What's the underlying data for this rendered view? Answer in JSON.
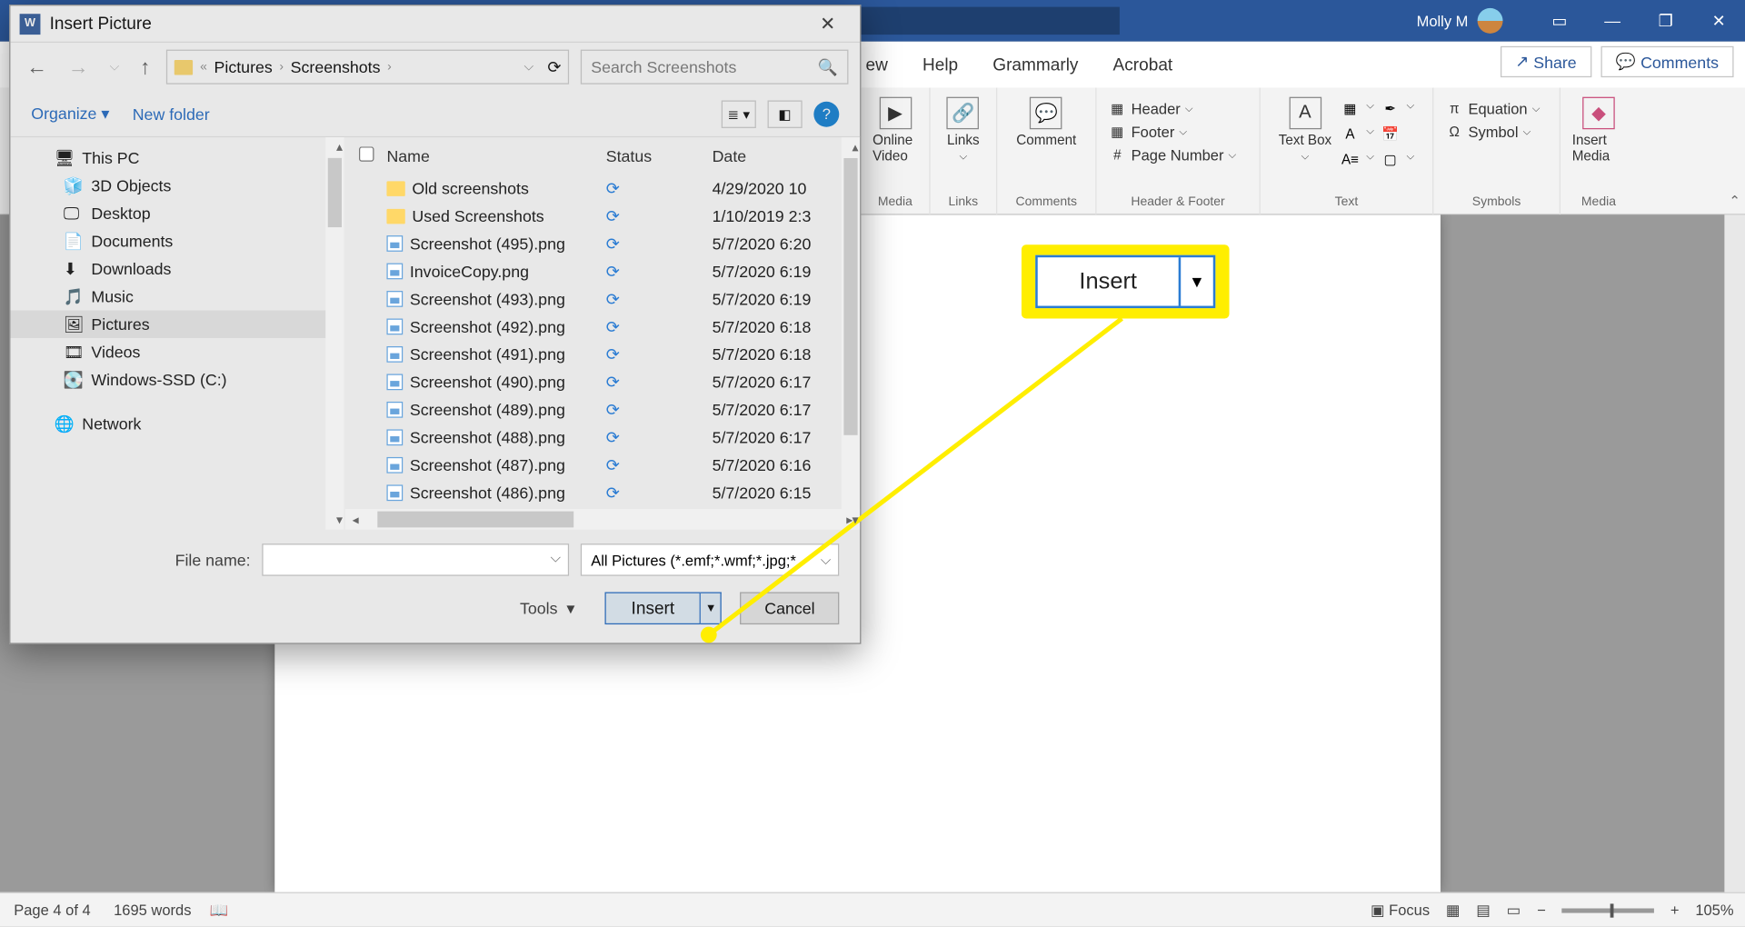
{
  "word": {
    "user": "Molly M",
    "tabs": [
      "ew",
      "Help",
      "Grammarly",
      "Acrobat"
    ],
    "share": "Share",
    "comments": "Comments",
    "ribbon": {
      "media_label": "Media",
      "online_video": "Online Video",
      "links_label": "Links",
      "links": "Links",
      "comments_label": "Comments",
      "comment": "Comment",
      "hf_label": "Header & Footer",
      "header": "Header",
      "footer": "Footer",
      "page_number": "Page Number",
      "text_label": "Text",
      "text_box": "Text Box",
      "symbols_label": "Symbols",
      "equation": "Equation",
      "symbol": "Symbol",
      "insert_media_label": "Media",
      "insert_media": "Insert Media"
    },
    "status": {
      "page": "Page 4 of 4",
      "words": "1695 words",
      "focus": "Focus",
      "zoom": "105%"
    }
  },
  "dialog": {
    "title": "Insert Picture",
    "breadcrumb": [
      "Pictures",
      "Screenshots"
    ],
    "search_placeholder": "Search Screenshots",
    "organize": "Organize",
    "new_folder": "New folder",
    "nav_items": [
      {
        "label": "This PC",
        "icon": "pc"
      },
      {
        "label": "3D Objects",
        "icon": "3d"
      },
      {
        "label": "Desktop",
        "icon": "desk"
      },
      {
        "label": "Documents",
        "icon": "doc"
      },
      {
        "label": "Downloads",
        "icon": "dl"
      },
      {
        "label": "Music",
        "icon": "mus"
      },
      {
        "label": "Pictures",
        "icon": "pic",
        "selected": true
      },
      {
        "label": "Videos",
        "icon": "vid"
      },
      {
        "label": "Windows-SSD (C:)",
        "icon": "drive"
      },
      {
        "label": "Network",
        "icon": "net",
        "top": true
      }
    ],
    "columns": {
      "name": "Name",
      "status": "Status",
      "date": "Date"
    },
    "files": [
      {
        "name": "Old screenshots",
        "type": "folder",
        "status": "sync",
        "date": "4/29/2020 10"
      },
      {
        "name": "Used Screenshots",
        "type": "folder",
        "status": "sync",
        "date": "1/10/2019 2:3"
      },
      {
        "name": "Screenshot (495).png",
        "type": "img",
        "status": "sync",
        "date": "5/7/2020 6:20"
      },
      {
        "name": "InvoiceCopy.png",
        "type": "img",
        "status": "sync",
        "date": "5/7/2020 6:19"
      },
      {
        "name": "Screenshot (493).png",
        "type": "img",
        "status": "sync",
        "date": "5/7/2020 6:19"
      },
      {
        "name": "Screenshot (492).png",
        "type": "img",
        "status": "sync",
        "date": "5/7/2020 6:18"
      },
      {
        "name": "Screenshot (491).png",
        "type": "img",
        "status": "sync",
        "date": "5/7/2020 6:18"
      },
      {
        "name": "Screenshot (490).png",
        "type": "img",
        "status": "sync",
        "date": "5/7/2020 6:17"
      },
      {
        "name": "Screenshot (489).png",
        "type": "img",
        "status": "sync",
        "date": "5/7/2020 6:17"
      },
      {
        "name": "Screenshot (488).png",
        "type": "img",
        "status": "sync",
        "date": "5/7/2020 6:17"
      },
      {
        "name": "Screenshot (487).png",
        "type": "img",
        "status": "sync",
        "date": "5/7/2020 6:16"
      },
      {
        "name": "Screenshot (486).png",
        "type": "img",
        "status": "sync",
        "date": "5/7/2020 6:15"
      }
    ],
    "file_name_label": "File name:",
    "filter": "All Pictures (*.emf;*.wmf;*.jpg;*.",
    "tools": "Tools",
    "insert": "Insert",
    "cancel": "Cancel"
  },
  "callout": {
    "label": "Insert"
  }
}
